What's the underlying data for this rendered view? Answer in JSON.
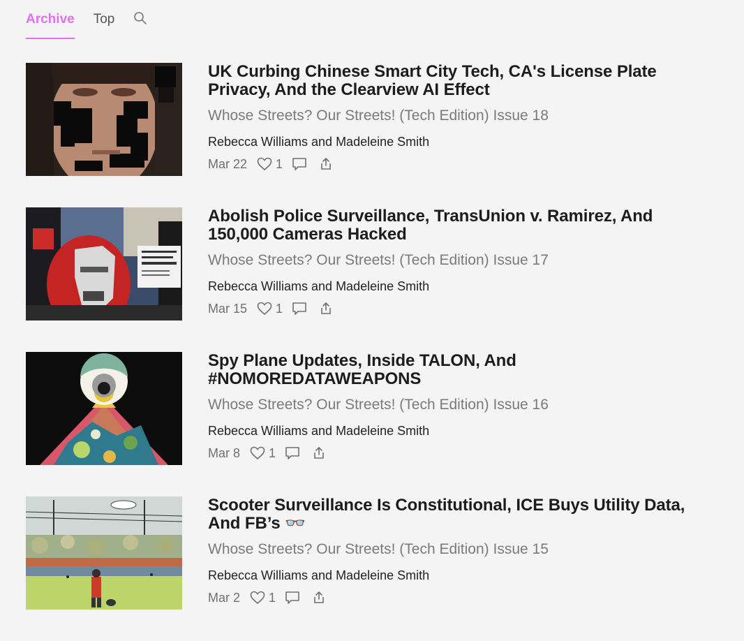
{
  "nav": {
    "tabs": [
      {
        "label": "Archive",
        "active": true
      },
      {
        "label": "Top",
        "active": false
      }
    ],
    "search_icon": "search-icon"
  },
  "accent_color": "#e36ff1",
  "posts": [
    {
      "title": "UK Curbing Chinese Smart City Tech, CA's License Plate Privacy, And the Clearview AI Effect",
      "subtitle": "Whose Streets? Our Streets! (Tech Edition) Issue 18",
      "authors": "Rebecca Williams and Madeleine Smith",
      "date": "Mar 22",
      "likes": "1"
    },
    {
      "title": "Abolish Police Surveillance, TransUnion v. Ramirez, And 150,000 Cameras Hacked",
      "subtitle": "Whose Streets? Our Streets! (Tech Edition) Issue 17",
      "authors": "Rebecca Williams and Madeleine Smith",
      "date": "Mar 15",
      "likes": "1"
    },
    {
      "title": "Spy Plane Updates, Inside TALON, And #NOMOREDATAWEAPONS",
      "subtitle": "Whose Streets? Our Streets! (Tech Edition) Issue 16",
      "authors": "Rebecca Williams and Madeleine Smith",
      "date": "Mar 8",
      "likes": "1"
    },
    {
      "title": "Scooter Surveillance Is Constitutional, ICE Buys Utility Data, And FB’s 👓",
      "subtitle": "Whose Streets? Our Streets! (Tech Edition) Issue 15",
      "authors": "Rebecca Williams and Madeleine Smith",
      "date": "Mar 2",
      "likes": "1"
    }
  ]
}
